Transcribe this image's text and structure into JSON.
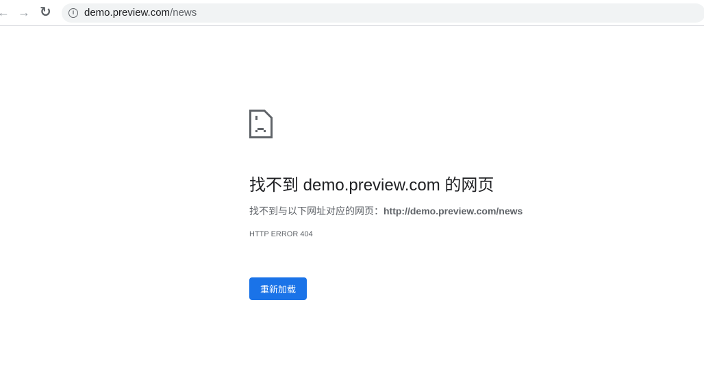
{
  "browser": {
    "url_host": "demo.preview.com",
    "url_path": "/news"
  },
  "error": {
    "title": "找不到 demo.preview.com 的网页",
    "desc_prefix": "找不到与以下网址对应的网页：",
    "desc_url": "http://demo.preview.com/news",
    "code": "HTTP ERROR 404",
    "reload_label": "重新加载"
  },
  "colors": {
    "accent": "#1a73e8"
  }
}
